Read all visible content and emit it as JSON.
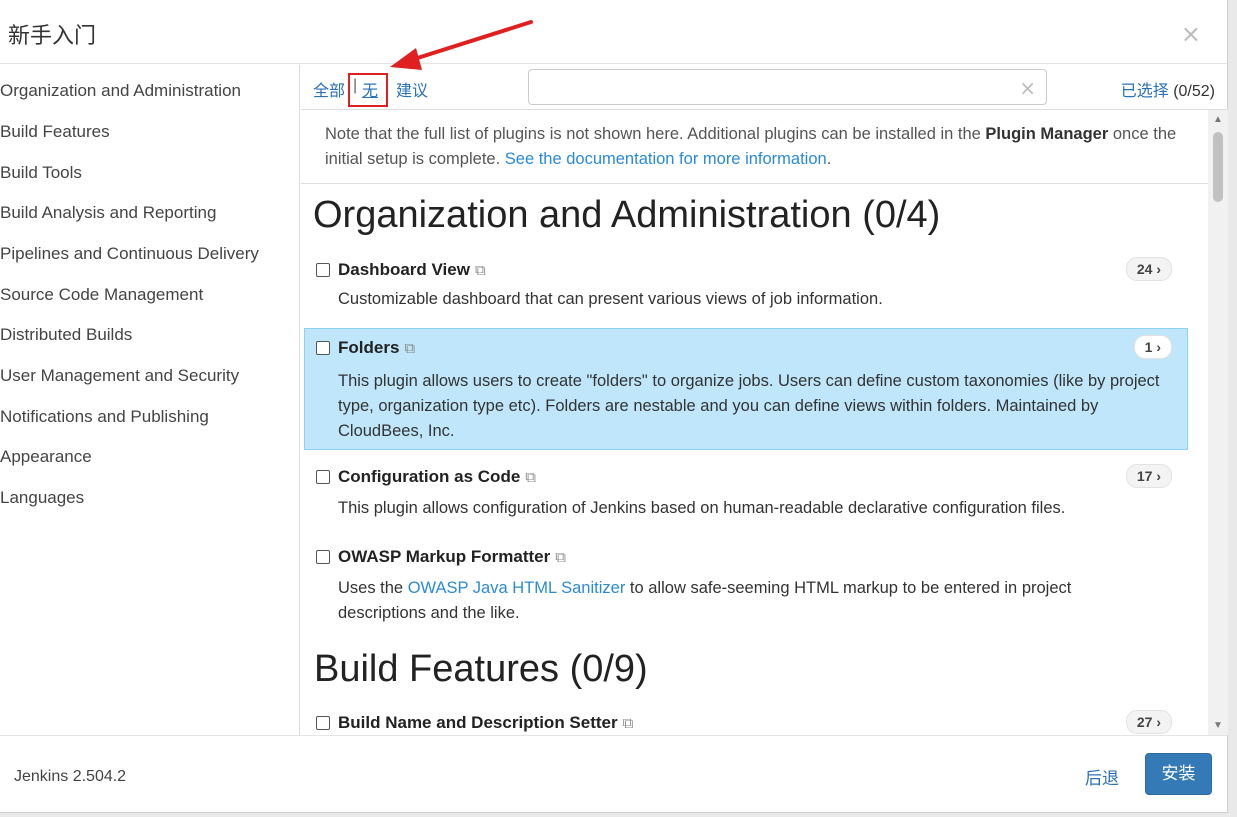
{
  "dialog": {
    "title": "新手入门",
    "close_glyph": "×"
  },
  "sidebar": {
    "items": [
      {
        "label": "Organization and Administration"
      },
      {
        "label": "Build Features"
      },
      {
        "label": "Build Tools"
      },
      {
        "label": "Build Analysis and Reporting"
      },
      {
        "label": "Pipelines and Continuous Delivery"
      },
      {
        "label": "Source Code Management"
      },
      {
        "label": "Distributed Builds"
      },
      {
        "label": "User Management and Security"
      },
      {
        "label": "Notifications and Publishing"
      },
      {
        "label": "Appearance"
      },
      {
        "label": "Languages"
      }
    ]
  },
  "toolbar": {
    "all_label": "全部",
    "separator": "|",
    "none_label": "无",
    "suggested_label": "建议",
    "search_placeholder": "",
    "search_clear_glyph": "×",
    "selected_label": "已选择",
    "selected_count": "(0/52)"
  },
  "note": {
    "text_before": "Note that the full list of plugins is not shown here. Additional plugins can be installed in the ",
    "bold": "Plugin Manager",
    "text_after": " once the initial setup is complete. ",
    "link": "See the documentation for more information",
    "end": "."
  },
  "sections": [
    {
      "title": "Organization and Administration (0/4)",
      "plugins": [
        {
          "name": "Dashboard View",
          "badge": "24 ›",
          "desc": "Customizable dashboard that can present various views of job information.",
          "selected": false
        },
        {
          "name": "Folders",
          "badge": "1 ›",
          "desc": "This plugin allows users to create \"folders\" to organize jobs. Users can define custom taxonomies (like by project type, organization type etc). Folders are nestable and you can define views within folders. Maintained by CloudBees, Inc.",
          "selected": true
        },
        {
          "name": "Configuration as Code",
          "badge": "17 ›",
          "desc": "This plugin allows configuration of Jenkins based on human-readable declarative configuration files.",
          "selected": false
        },
        {
          "name": "OWASP Markup Formatter",
          "badge": "",
          "desc_before": "Uses the ",
          "desc_link": "OWASP Java HTML Sanitizer",
          "desc_after": " to allow safe-seeming HTML markup to be entered in project descriptions and the like.",
          "selected": false
        }
      ]
    },
    {
      "title": "Build Features (0/9)",
      "plugins": [
        {
          "name": "Build Name and Description Setter",
          "badge": "27 ›",
          "selected": false
        }
      ]
    }
  ],
  "icons": {
    "external_link": "external-link-icon",
    "close": "close-icon",
    "clear": "clear-icon"
  },
  "footer": {
    "version": "Jenkins 2.504.2",
    "back_label": "后退",
    "install_label": "安装"
  },
  "colors": {
    "link": "#2a71b8",
    "selected_row": "#bfe6fa",
    "install_button": "#337ab7",
    "annotation": "#e02020"
  }
}
